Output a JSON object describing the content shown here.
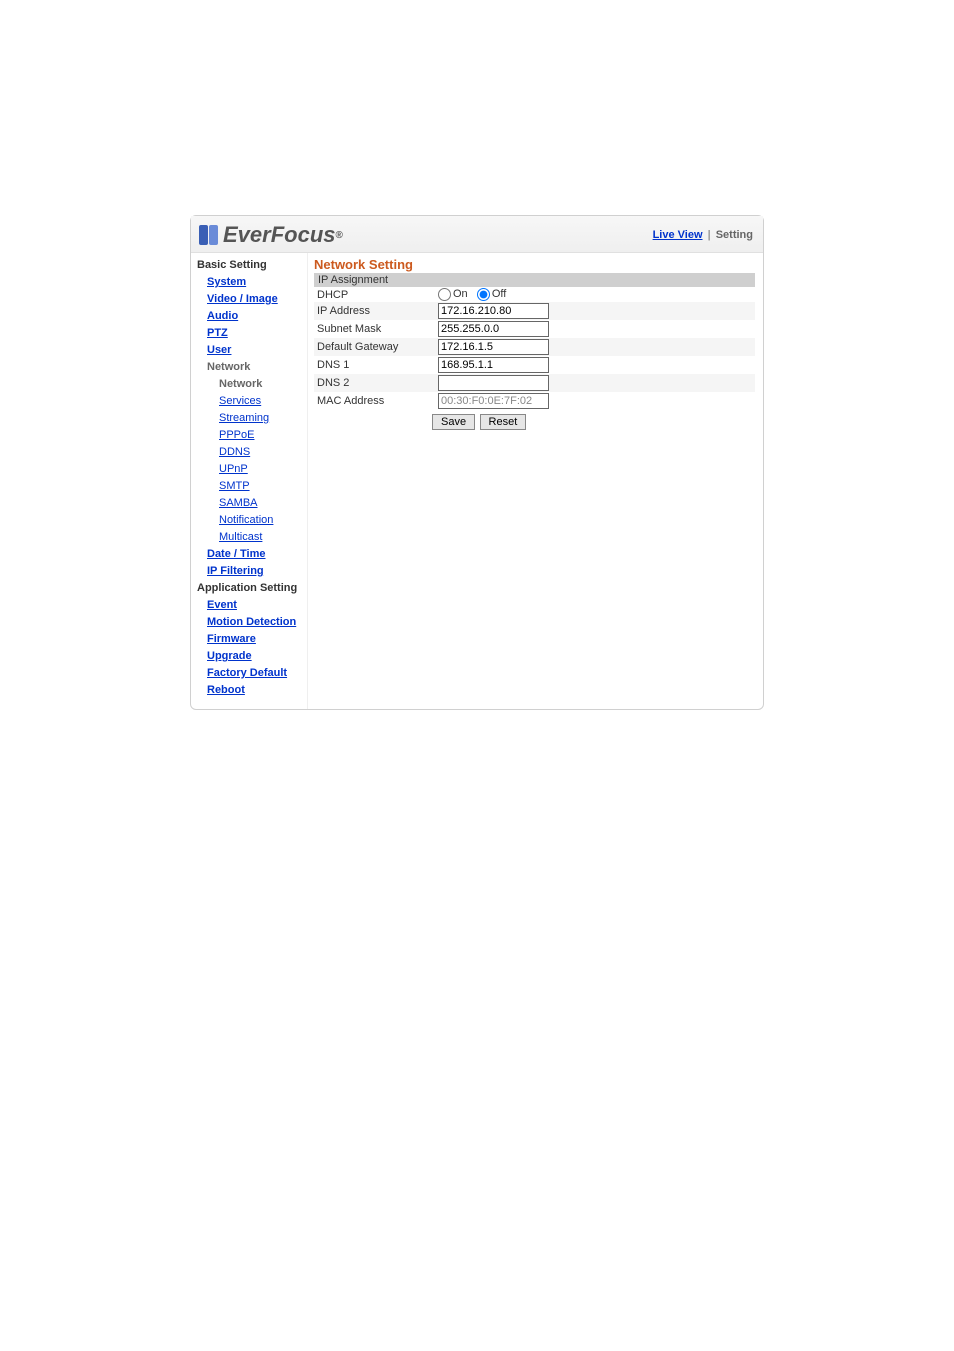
{
  "brand": "EverFocus",
  "topnav": {
    "live_view": "Live View",
    "setting": "Setting"
  },
  "sidebar": {
    "basic_heading": "Basic Setting",
    "system": "System",
    "video_image": "Video / Image",
    "audio": "Audio",
    "ptz": "PTZ",
    "user": "User",
    "network_parent": "Network",
    "network": "Network",
    "services": "Services",
    "streaming": "Streaming",
    "pppoe": "PPPoE",
    "ddns": "DDNS",
    "upnp": "UPnP",
    "smtp": "SMTP",
    "samba": "SAMBA",
    "notification": "Notification",
    "multicast": "Multicast",
    "date_time": "Date / Time",
    "ip_filtering": "IP Filtering",
    "app_heading": "Application Setting",
    "event": "Event",
    "motion": "Motion Detection",
    "firmware": "Firmware",
    "upgrade": "Upgrade",
    "factory": "Factory Default",
    "reboot": "Reboot"
  },
  "content": {
    "title": "Network Setting",
    "section": "IP Assignment",
    "dhcp_label": "DHCP",
    "dhcp_on": "On",
    "dhcp_off": "Off",
    "ip_label": "IP Address",
    "ip_value": "172.16.210.80",
    "subnet_label": "Subnet Mask",
    "subnet_value": "255.255.0.0",
    "gateway_label": "Default Gateway",
    "gateway_value": "172.16.1.5",
    "dns1_label": "DNS 1",
    "dns1_value": "168.95.1.1",
    "dns2_label": "DNS 2",
    "dns2_value": "",
    "mac_label": "MAC Address",
    "mac_value": "00:30:F0:0E:7F:02",
    "save_btn": "Save",
    "reset_btn": "Reset"
  }
}
